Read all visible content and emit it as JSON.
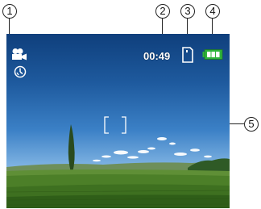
{
  "callouts": [
    "1",
    "2",
    "3",
    "4",
    "5"
  ],
  "screen": {
    "mode_icon": "movie-camera-icon",
    "self_timer_icon": "self-timer-icon",
    "recording_time": "00:49",
    "storage_icon": "memory-card-icon",
    "battery_icon": "battery-full-icon",
    "focus_frame_icon": "focus-frame-brackets",
    "colors": {
      "battery": "#2fb43a",
      "overlay_text": "#ffffff"
    }
  }
}
